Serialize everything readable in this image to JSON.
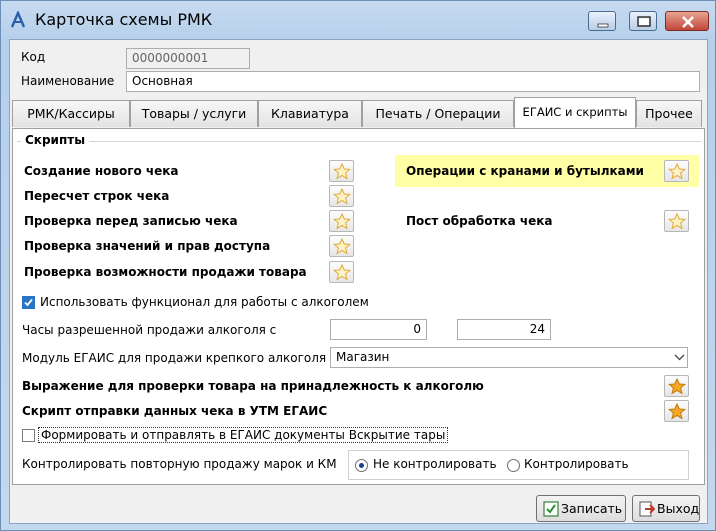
{
  "window": {
    "title": "Карточка схемы РМК"
  },
  "fields": {
    "code_label": "Код",
    "code_value": "0000000001",
    "name_label": "Наименование",
    "name_value": "Основная"
  },
  "tabs": [
    {
      "label": "РМК/Кассиры"
    },
    {
      "label": "Товары / услуги"
    },
    {
      "label": "Клавиатура"
    },
    {
      "label": "Печать / Операции"
    },
    {
      "label": "ЕГАИС и скрипты",
      "active": true
    },
    {
      "label": "Прочее"
    }
  ],
  "scripts": {
    "group_title": "Скрипты",
    "left": [
      "Создание нового чека",
      "Пересчет строк чека",
      "Проверка перед записью чека",
      "Проверка значений и прав доступа",
      "Проверка возможности продажи товара"
    ],
    "right": [
      "Операции с кранами и бутылками",
      "Пост обработка чека"
    ]
  },
  "alcohol": {
    "use_label": "Использовать функционал для работы с алкоголем",
    "use_checked": true,
    "hours_label": "Часы разрешенной продажи алкоголя с",
    "hours_from": "0",
    "hours_to": "24",
    "module_label": "Модуль ЕГАИС для продажи крепкого алкоголя",
    "module_value": "Магазин",
    "expr_label": "Выражение для проверки товара на принадлежность к алкоголю",
    "script_label": "Скрипт отправки данных чека в УТМ ЕГАИС",
    "opening_label": "Формировать и отправлять в ЕГАИС документы Вскрытие тары",
    "opening_checked": false,
    "control_label": "Контролировать повторную продажу марок и КМ",
    "control_options": [
      "Не контролировать",
      "Контролировать"
    ],
    "control_selected": "Не контролировать"
  },
  "buttons": {
    "save": "Записать",
    "exit": "Выход"
  },
  "colors": {
    "highlight": "#ffffa6",
    "star_active": "#f5a623",
    "star_inactive": "#f6d58a"
  }
}
